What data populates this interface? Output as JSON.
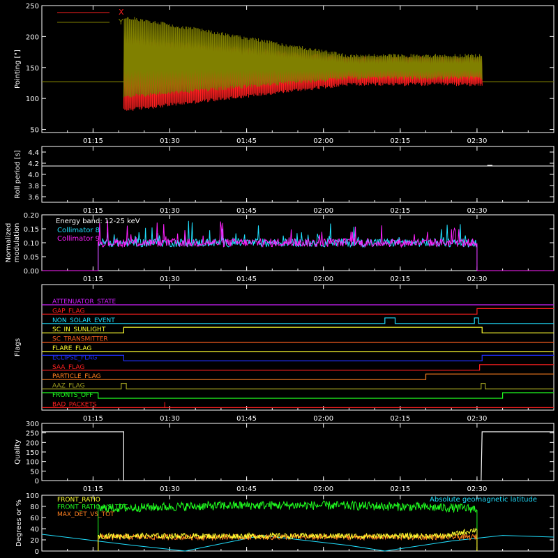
{
  "colors": {
    "background": "#000000",
    "axes": "#ffffff",
    "red": "#ff2020",
    "olive": "#808000",
    "cyan": "#20e0ff",
    "magenta": "#ff20ff",
    "blue": "#2030ff",
    "yellow": "#ffff30",
    "orange": "#ff8020",
    "green": "#20ff20",
    "white": "#ffffff",
    "purple": "#d020ff",
    "olive_flag": "#a0a020",
    "orangered": "#ff6020"
  },
  "time_axis": {
    "min": "01:05",
    "max": "02:45",
    "ticks": [
      "01:15",
      "01:30",
      "01:45",
      "02:00",
      "02:15",
      "02:30"
    ]
  },
  "chart_data": [
    {
      "type": "line",
      "id": "pointing",
      "ylabel": "Pointing [\"]",
      "ylim": [
        45,
        250
      ],
      "yticks": [
        "50",
        "100",
        "150",
        "200",
        "250"
      ],
      "legend_placement": "top-left",
      "series": [
        {
          "name": "X",
          "color": "red",
          "baseline": 127,
          "start": "01:21",
          "end": "02:31",
          "band_start": [
            78,
            200
          ],
          "band_end": [
            120,
            168
          ]
        },
        {
          "name": "Y",
          "color": "olive",
          "baseline": 127,
          "start": "01:21",
          "end": "02:31",
          "band_start": [
            100,
            235
          ],
          "band_end": [
            130,
            172
          ]
        }
      ]
    },
    {
      "type": "line",
      "id": "roll",
      "ylabel": "Roll period [s]",
      "ylim": [
        3.5,
        4.5
      ],
      "yticks": [
        "3.6",
        "3.8",
        "4.0",
        "4.2",
        "4.4"
      ],
      "series": [
        {
          "name": "",
          "color": "white",
          "value": 4.15
        }
      ]
    },
    {
      "type": "line",
      "id": "modulation",
      "ylabel": "Normalized modulation",
      "ylim": [
        0.0,
        0.2
      ],
      "yticks": [
        "0.00",
        "0.05",
        "0.10",
        "0.15",
        "0.20"
      ],
      "annotation": "Energy band: 12-25 keV",
      "legend_placement": "top-left",
      "series": [
        {
          "name": "Collimator 8",
          "color": "cyan",
          "start": "01:16",
          "end": "02:30",
          "mean": 0.1
        },
        {
          "name": "Collimator 9",
          "color": "magenta",
          "start": "01:16",
          "end": "02:30",
          "mean": 0.1
        }
      ]
    },
    {
      "type": "line",
      "id": "flags",
      "ylabel": "Flags",
      "series": [
        {
          "name": "ATTENUATOR_STATE",
          "color": "purple",
          "segments": [
            [
              "01:05",
              "02:45",
              0
            ]
          ]
        },
        {
          "name": "GAP_FLAG",
          "color": "red",
          "segments": [
            [
              "01:05",
              "02:30",
              0
            ],
            [
              "02:30",
              "02:45",
              1
            ]
          ]
        },
        {
          "name": "NON_SOLAR_EVENT",
          "color": "cyan",
          "segments": [
            [
              "01:05",
              "02:12",
              0
            ],
            [
              "02:12",
              "02:14",
              1
            ],
            [
              "02:14",
              "02:29.5",
              0
            ],
            [
              "02:29.5",
              "02:30.3",
              1
            ],
            [
              "02:30.3",
              "02:45",
              0
            ]
          ]
        },
        {
          "name": "SC_IN_SUNLIGHT",
          "color": "yellow",
          "segments": [
            [
              "01:05",
              "01:21",
              0
            ],
            [
              "01:21",
              "02:31",
              1
            ],
            [
              "02:31",
              "02:45",
              0
            ]
          ]
        },
        {
          "name": "SC_TRANSMITTER",
          "color": "orangered",
          "segments": [
            [
              "01:05",
              "02:45",
              0
            ]
          ]
        },
        {
          "name": "FLARE_FLAG",
          "color": "yellow",
          "segments": [
            [
              "01:05",
              "02:45",
              0
            ]
          ]
        },
        {
          "name": "ECLIPSE_FLAG",
          "color": "blue",
          "segments": [
            [
              "01:05",
              "01:21",
              1
            ],
            [
              "01:21",
              "02:31",
              0
            ],
            [
              "02:31",
              "02:45",
              1
            ]
          ]
        },
        {
          "name": "SAA_FLAG",
          "color": "red",
          "segments": [
            [
              "01:05",
              "02:30.5",
              0
            ],
            [
              "02:30.5",
              "02:45",
              1
            ]
          ]
        },
        {
          "name": "PARTICLE_FLAG",
          "color": "orange",
          "segments": [
            [
              "01:05",
              "02:20",
              0
            ],
            [
              "02:20",
              "02:45",
              1
            ]
          ]
        },
        {
          "name": "AAZ_FLAG",
          "color": "olive_flag",
          "segments": [
            [
              "01:05",
              "01:20.5",
              0
            ],
            [
              "01:20.5",
              "01:21.5",
              1
            ],
            [
              "01:21.5",
              "02:30.8",
              0
            ],
            [
              "02:30.8",
              "02:31.6",
              1
            ],
            [
              "02:31.6",
              "02:45",
              0
            ]
          ]
        },
        {
          "name": "FRONTS_OFF",
          "color": "green",
          "segments": [
            [
              "01:05",
              "01:16",
              1
            ],
            [
              "01:16",
              "02:35",
              0
            ],
            [
              "02:35",
              "02:45",
              1
            ]
          ]
        },
        {
          "name": "BAD_PACKETS",
          "color": "red",
          "segments": [
            [
              "01:05",
              "02:45",
              0
            ]
          ],
          "spikes": [
            "01:29"
          ]
        }
      ]
    },
    {
      "type": "line",
      "id": "quality",
      "ylabel": "Quality",
      "ylim": [
        0,
        300
      ],
      "yticks": [
        "0",
        "50",
        "100",
        "150",
        "200",
        "250",
        "300"
      ],
      "series": [
        {
          "name": "",
          "color": "white",
          "steps": [
            [
              "01:05",
              256
            ],
            [
              "01:21",
              256
            ],
            [
              "01:21",
              0
            ],
            [
              "02:30.8",
              0
            ],
            [
              "02:31",
              256
            ],
            [
              "02:45",
              256
            ]
          ]
        }
      ]
    },
    {
      "type": "line",
      "id": "ratios",
      "ylabel": "Degrees or %",
      "ylim": [
        0,
        100
      ],
      "yticks": [
        "0",
        "20",
        "40",
        "60",
        "80",
        "100"
      ],
      "legend_placement": "top-left",
      "annotation": "Absolute geomagnetic latitude",
      "series": [
        {
          "name": "FRONT_RATIO",
          "color": "yellow",
          "start": "01:16",
          "end": "02:30",
          "level": 27
        },
        {
          "name": "FRONT_RATIO_VS_TOT",
          "color": "green",
          "start": "01:16",
          "end": "02:30",
          "level": 80
        },
        {
          "name": "MAX_DET_VS_TOT",
          "color": "orange",
          "start": "01:16",
          "end": "02:30",
          "level": 25
        },
        {
          "name": "Absolute geomagnetic latitude",
          "color": "cyan",
          "points": [
            [
              "01:05",
              30
            ],
            [
              "01:23",
              10
            ],
            [
              "01:33",
              0
            ],
            [
              "01:48",
              28
            ],
            [
              "02:05",
              10
            ],
            [
              "02:12",
              0
            ],
            [
              "02:25",
              18
            ],
            [
              "02:35",
              28
            ],
            [
              "02:45",
              25
            ]
          ]
        }
      ]
    }
  ]
}
